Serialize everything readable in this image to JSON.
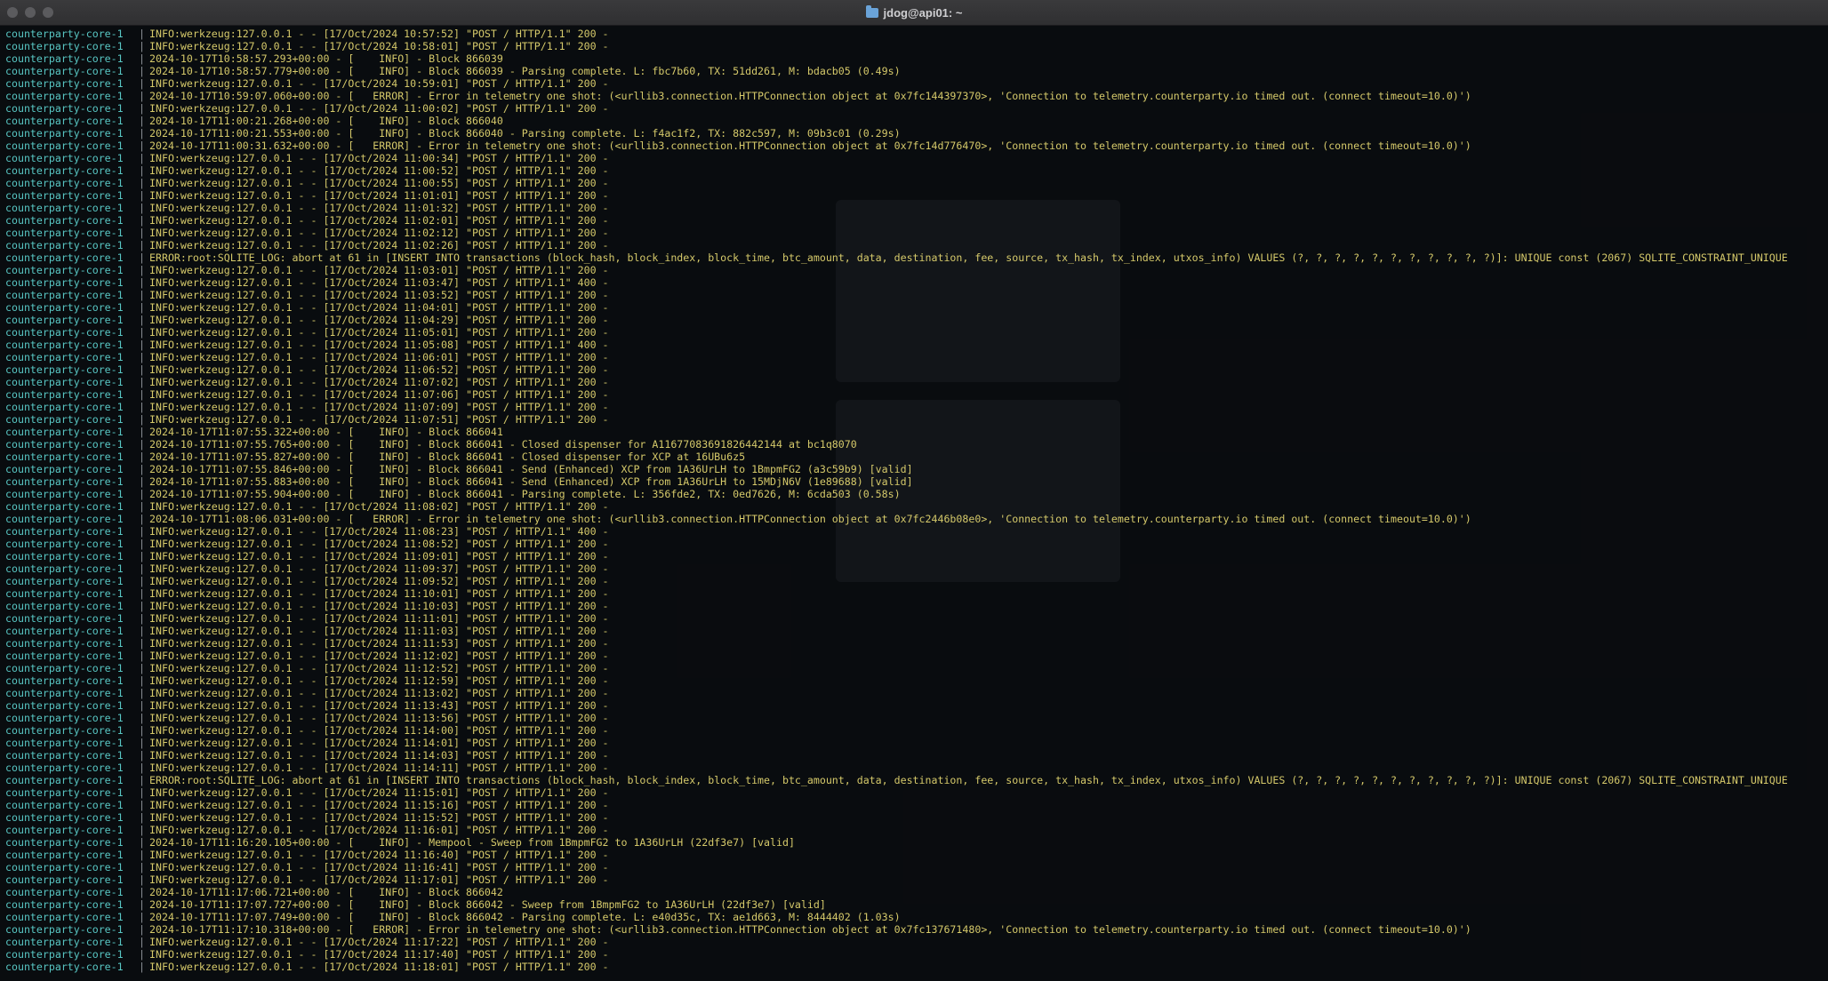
{
  "window": {
    "title": "jdog@api01: ~",
    "folder_icon": "folder-icon"
  },
  "service": "counterparty-core-1",
  "separator": "|",
  "lines": [
    "INFO:werkzeug:127.0.0.1 - - [17/Oct/2024 10:57:52] \"POST / HTTP/1.1\" 200 -",
    "INFO:werkzeug:127.0.0.1 - - [17/Oct/2024 10:58:01] \"POST / HTTP/1.1\" 200 -",
    "2024-10-17T10:58:57.293+00:00 - [    INFO] - Block 866039",
    "2024-10-17T10:58:57.779+00:00 - [    INFO] - Block 866039 - Parsing complete. L: fbc7b60, TX: 51dd261, M: bdacb05 (0.49s)",
    "INFO:werkzeug:127.0.0.1 - - [17/Oct/2024 10:59:01] \"POST / HTTP/1.1\" 200 -",
    "2024-10-17T10:59:07.060+00:00 - [   ERROR] - Error in telemetry one shot: (<urllib3.connection.HTTPConnection object at 0x7fc144397370>, 'Connection to telemetry.counterparty.io timed out. (connect timeout=10.0)')",
    "INFO:werkzeug:127.0.0.1 - - [17/Oct/2024 11:00:02] \"POST / HTTP/1.1\" 200 -",
    "2024-10-17T11:00:21.268+00:00 - [    INFO] - Block 866040",
    "2024-10-17T11:00:21.553+00:00 - [    INFO] - Block 866040 - Parsing complete. L: f4ac1f2, TX: 882c597, M: 09b3c01 (0.29s)",
    "2024-10-17T11:00:31.632+00:00 - [   ERROR] - Error in telemetry one shot: (<urllib3.connection.HTTPConnection object at 0x7fc14d776470>, 'Connection to telemetry.counterparty.io timed out. (connect timeout=10.0)')",
    "INFO:werkzeug:127.0.0.1 - - [17/Oct/2024 11:00:34] \"POST / HTTP/1.1\" 200 -",
    "INFO:werkzeug:127.0.0.1 - - [17/Oct/2024 11:00:52] \"POST / HTTP/1.1\" 200 -",
    "INFO:werkzeug:127.0.0.1 - - [17/Oct/2024 11:00:55] \"POST / HTTP/1.1\" 200 -",
    "INFO:werkzeug:127.0.0.1 - - [17/Oct/2024 11:01:01] \"POST / HTTP/1.1\" 200 -",
    "INFO:werkzeug:127.0.0.1 - - [17/Oct/2024 11:01:32] \"POST / HTTP/1.1\" 200 -",
    "INFO:werkzeug:127.0.0.1 - - [17/Oct/2024 11:02:01] \"POST / HTTP/1.1\" 200 -",
    "INFO:werkzeug:127.0.0.1 - - [17/Oct/2024 11:02:12] \"POST / HTTP/1.1\" 200 -",
    "INFO:werkzeug:127.0.0.1 - - [17/Oct/2024 11:02:26] \"POST / HTTP/1.1\" 200 -",
    "ERROR:root:SQLITE_LOG: abort at 61 in [INSERT INTO transactions (block_hash, block_index, block_time, btc_amount, data, destination, fee, source, tx_hash, tx_index, utxos_info) VALUES (?, ?, ?, ?, ?, ?, ?, ?, ?, ?, ?)]: UNIQUE const (2067) SQLITE_CONSTRAINT_UNIQUE",
    "INFO:werkzeug:127.0.0.1 - - [17/Oct/2024 11:03:01] \"POST / HTTP/1.1\" 200 -",
    "INFO:werkzeug:127.0.0.1 - - [17/Oct/2024 11:03:47] \"POST / HTTP/1.1\" 400 -",
    "INFO:werkzeug:127.0.0.1 - - [17/Oct/2024 11:03:52] \"POST / HTTP/1.1\" 200 -",
    "INFO:werkzeug:127.0.0.1 - - [17/Oct/2024 11:04:01] \"POST / HTTP/1.1\" 200 -",
    "INFO:werkzeug:127.0.0.1 - - [17/Oct/2024 11:04:29] \"POST / HTTP/1.1\" 200 -",
    "INFO:werkzeug:127.0.0.1 - - [17/Oct/2024 11:05:01] \"POST / HTTP/1.1\" 200 -",
    "INFO:werkzeug:127.0.0.1 - - [17/Oct/2024 11:05:08] \"POST / HTTP/1.1\" 400 -",
    "INFO:werkzeug:127.0.0.1 - - [17/Oct/2024 11:06:01] \"POST / HTTP/1.1\" 200 -",
    "INFO:werkzeug:127.0.0.1 - - [17/Oct/2024 11:06:52] \"POST / HTTP/1.1\" 200 -",
    "INFO:werkzeug:127.0.0.1 - - [17/Oct/2024 11:07:02] \"POST / HTTP/1.1\" 200 -",
    "INFO:werkzeug:127.0.0.1 - - [17/Oct/2024 11:07:06] \"POST / HTTP/1.1\" 200 -",
    "INFO:werkzeug:127.0.0.1 - - [17/Oct/2024 11:07:09] \"POST / HTTP/1.1\" 200 -",
    "INFO:werkzeug:127.0.0.1 - - [17/Oct/2024 11:07:51] \"POST / HTTP/1.1\" 200 -",
    "2024-10-17T11:07:55.322+00:00 - [    INFO] - Block 866041",
    "2024-10-17T11:07:55.765+00:00 - [    INFO] - Block 866041 - Closed dispenser for A11677083691826442144 at bc1q8070",
    "2024-10-17T11:07:55.827+00:00 - [    INFO] - Block 866041 - Closed dispenser for XCP at 16UBu6z5",
    "2024-10-17T11:07:55.846+00:00 - [    INFO] - Block 866041 - Send (Enhanced) XCP from 1A36UrLH to 1BmpmFG2 (a3c59b9) [valid]",
    "2024-10-17T11:07:55.883+00:00 - [    INFO] - Block 866041 - Send (Enhanced) XCP from 1A36UrLH to 15MDjN6V (1e89688) [valid]",
    "2024-10-17T11:07:55.904+00:00 - [    INFO] - Block 866041 - Parsing complete. L: 356fde2, TX: 0ed7626, M: 6cda503 (0.58s)",
    "INFO:werkzeug:127.0.0.1 - - [17/Oct/2024 11:08:02] \"POST / HTTP/1.1\" 200 -",
    "2024-10-17T11:08:06.031+00:00 - [   ERROR] - Error in telemetry one shot: (<urllib3.connection.HTTPConnection object at 0x7fc2446b08e0>, 'Connection to telemetry.counterparty.io timed out. (connect timeout=10.0)')",
    "INFO:werkzeug:127.0.0.1 - - [17/Oct/2024 11:08:23] \"POST / HTTP/1.1\" 400 -",
    "INFO:werkzeug:127.0.0.1 - - [17/Oct/2024 11:08:52] \"POST / HTTP/1.1\" 200 -",
    "INFO:werkzeug:127.0.0.1 - - [17/Oct/2024 11:09:01] \"POST / HTTP/1.1\" 200 -",
    "INFO:werkzeug:127.0.0.1 - - [17/Oct/2024 11:09:37] \"POST / HTTP/1.1\" 200 -",
    "INFO:werkzeug:127.0.0.1 - - [17/Oct/2024 11:09:52] \"POST / HTTP/1.1\" 200 -",
    "INFO:werkzeug:127.0.0.1 - - [17/Oct/2024 11:10:01] \"POST / HTTP/1.1\" 200 -",
    "INFO:werkzeug:127.0.0.1 - - [17/Oct/2024 11:10:03] \"POST / HTTP/1.1\" 200 -",
    "INFO:werkzeug:127.0.0.1 - - [17/Oct/2024 11:11:01] \"POST / HTTP/1.1\" 200 -",
    "INFO:werkzeug:127.0.0.1 - - [17/Oct/2024 11:11:03] \"POST / HTTP/1.1\" 200 -",
    "INFO:werkzeug:127.0.0.1 - - [17/Oct/2024 11:11:53] \"POST / HTTP/1.1\" 200 -",
    "INFO:werkzeug:127.0.0.1 - - [17/Oct/2024 11:12:02] \"POST / HTTP/1.1\" 200 -",
    "INFO:werkzeug:127.0.0.1 - - [17/Oct/2024 11:12:52] \"POST / HTTP/1.1\" 200 -",
    "INFO:werkzeug:127.0.0.1 - - [17/Oct/2024 11:12:59] \"POST / HTTP/1.1\" 200 -",
    "INFO:werkzeug:127.0.0.1 - - [17/Oct/2024 11:13:02] \"POST / HTTP/1.1\" 200 -",
    "INFO:werkzeug:127.0.0.1 - - [17/Oct/2024 11:13:43] \"POST / HTTP/1.1\" 200 -",
    "INFO:werkzeug:127.0.0.1 - - [17/Oct/2024 11:13:56] \"POST / HTTP/1.1\" 200 -",
    "INFO:werkzeug:127.0.0.1 - - [17/Oct/2024 11:14:00] \"POST / HTTP/1.1\" 200 -",
    "INFO:werkzeug:127.0.0.1 - - [17/Oct/2024 11:14:01] \"POST / HTTP/1.1\" 200 -",
    "INFO:werkzeug:127.0.0.1 - - [17/Oct/2024 11:14:03] \"POST / HTTP/1.1\" 200 -",
    "INFO:werkzeug:127.0.0.1 - - [17/Oct/2024 11:14:11] \"POST / HTTP/1.1\" 200 -",
    "ERROR:root:SQLITE_LOG: abort at 61 in [INSERT INTO transactions (block_hash, block_index, block_time, btc_amount, data, destination, fee, source, tx_hash, tx_index, utxos_info) VALUES (?, ?, ?, ?, ?, ?, ?, ?, ?, ?, ?)]: UNIQUE const (2067) SQLITE_CONSTRAINT_UNIQUE",
    "INFO:werkzeug:127.0.0.1 - - [17/Oct/2024 11:15:01] \"POST / HTTP/1.1\" 200 -",
    "INFO:werkzeug:127.0.0.1 - - [17/Oct/2024 11:15:16] \"POST / HTTP/1.1\" 200 -",
    "INFO:werkzeug:127.0.0.1 - - [17/Oct/2024 11:15:52] \"POST / HTTP/1.1\" 200 -",
    "INFO:werkzeug:127.0.0.1 - - [17/Oct/2024 11:16:01] \"POST / HTTP/1.1\" 200 -",
    "2024-10-17T11:16:20.105+00:00 - [    INFO] - Mempool - Sweep from 1BmpmFG2 to 1A36UrLH (22df3e7) [valid]",
    "INFO:werkzeug:127.0.0.1 - - [17/Oct/2024 11:16:40] \"POST / HTTP/1.1\" 200 -",
    "INFO:werkzeug:127.0.0.1 - - [17/Oct/2024 11:16:41] \"POST / HTTP/1.1\" 200 -",
    "INFO:werkzeug:127.0.0.1 - - [17/Oct/2024 11:17:01] \"POST / HTTP/1.1\" 200 -",
    "2024-10-17T11:17:06.721+00:00 - [    INFO] - Block 866042",
    "2024-10-17T11:17:07.727+00:00 - [    INFO] - Block 866042 - Sweep from 1BmpmFG2 to 1A36UrLH (22df3e7) [valid]",
    "2024-10-17T11:17:07.749+00:00 - [    INFO] - Block 866042 - Parsing complete. L: e40d35c, TX: ae1d663, M: 8444402 (1.03s)",
    "2024-10-17T11:17:10.318+00:00 - [   ERROR] - Error in telemetry one shot: (<urllib3.connection.HTTPConnection object at 0x7fc137671480>, 'Connection to telemetry.counterparty.io timed out. (connect timeout=10.0)')",
    "INFO:werkzeug:127.0.0.1 - - [17/Oct/2024 11:17:22] \"POST / HTTP/1.1\" 200 -",
    "INFO:werkzeug:127.0.0.1 - - [17/Oct/2024 11:17:40] \"POST / HTTP/1.1\" 200 -",
    "INFO:werkzeug:127.0.0.1 - - [17/Oct/2024 11:18:01] \"POST / HTTP/1.1\" 200 -"
  ],
  "colors": {
    "service": "#58c6c3",
    "message": "#d5c96a",
    "background": "#0d0f12"
  }
}
